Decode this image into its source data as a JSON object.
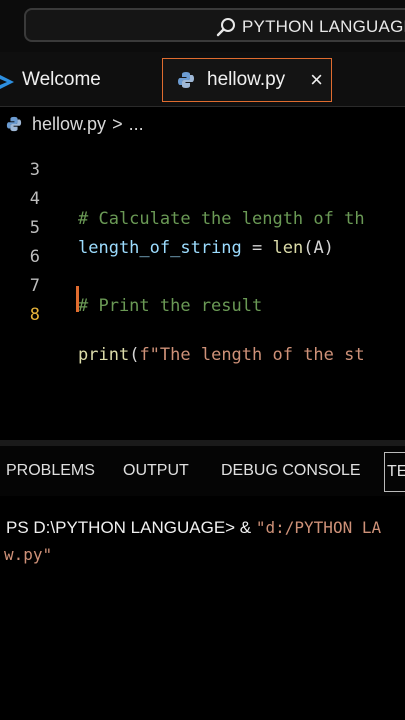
{
  "search": {
    "text": "PYTHON LANGUAGE"
  },
  "tabs": [
    {
      "label": "Welcome"
    },
    {
      "label": "hellow.py",
      "close": "×"
    }
  ],
  "breadcrumb": {
    "file": "hellow.py",
    "sep": ">",
    "more": "..."
  },
  "editor": {
    "lines": [
      {
        "number": "3",
        "code": ""
      },
      {
        "number": "4",
        "comment": "# Calculate the length of th"
      },
      {
        "number": "5",
        "ident": "length_of_string",
        "op": " = ",
        "fn": "len",
        "args": "(A)"
      },
      {
        "number": "6",
        "code": ""
      },
      {
        "number": "7",
        "comment": "# Print the result"
      },
      {
        "number": "8",
        "fn": "print",
        "open": "(",
        "str": "f\"The length of the st"
      }
    ]
  },
  "panel": {
    "tabs": [
      "PROBLEMS",
      "OUTPUT",
      "DEBUG CONSOLE",
      "TE"
    ],
    "terminal": {
      "prompt": "PS D:\\PYTHON LANGUAGE> & ",
      "cmd_part1": "\"d:/PYTHON LA",
      "cmd_part2": "w.py\""
    }
  },
  "colors": {
    "active_tab_border": "#e06c2f",
    "comment": "#6a9955",
    "string": "#ce9178",
    "function": "#dcdcaa",
    "identifier": "#9cdcfe",
    "active_line_number": "#e6b33a"
  }
}
